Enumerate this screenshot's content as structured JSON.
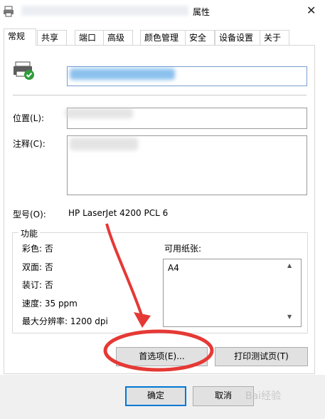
{
  "window": {
    "title_suffix": "属性",
    "close_glyph": "✕"
  },
  "tabs": [
    {
      "label": "常规"
    },
    {
      "label": "共享"
    },
    {
      "label": "端口"
    },
    {
      "label": "高级"
    },
    {
      "label": "颜色管理"
    },
    {
      "label": "安全"
    },
    {
      "label": "设备设置"
    },
    {
      "label": "关于"
    }
  ],
  "general": {
    "location_label": "位置(L):",
    "comment_label": "注释(C):",
    "model_label": "型号(O):",
    "model_value": "HP LaserJet 4200 PCL 6"
  },
  "features": {
    "group_title": "功能",
    "items": [
      "彩色: 否",
      "双面: 否",
      "装订: 否",
      "速度: 35 ppm",
      "最大分辨率: 1200 dpi"
    ],
    "paper_label": "可用纸张:",
    "paper_items": [
      "A4"
    ]
  },
  "buttons": {
    "preferences": "首选项(E)...",
    "print_test": "打印测试页(T)",
    "ok": "确定",
    "cancel": "取消"
  },
  "watermark": "Bai经验",
  "icons": {
    "title_icon": "printer-icon",
    "main_icon": "printer-default-icon",
    "annotation": "red-arrow-and-circle"
  },
  "colors": {
    "accent": "#0078d7",
    "annotation": "#e53935"
  }
}
